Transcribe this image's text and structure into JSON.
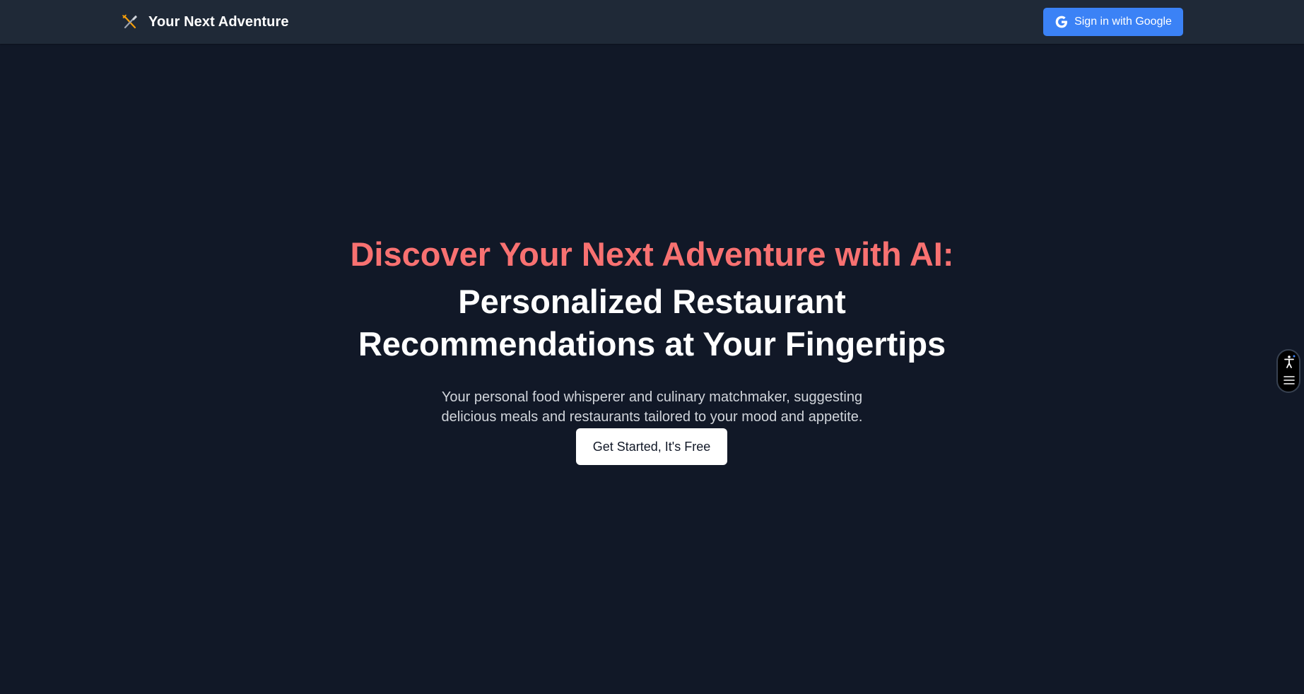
{
  "navbar": {
    "brand_icon": "fork-knife-icon",
    "brand_title": "Your Next Adventure",
    "signin_icon": "google-g-icon",
    "signin_label": "Sign in with Google"
  },
  "hero": {
    "headline_accent": "Discover Your Next Adventure with AI:",
    "headline_main_line1": "Personalized Restaurant",
    "headline_main_line2": "Recommendations at Your Fingertips",
    "subtitle_line1": "Your personal food whisperer and culinary matchmaker, suggesting",
    "subtitle_line2": "delicious meals and restaurants tailored to your mood and appetite.",
    "cta_label": "Get Started, It's Free"
  },
  "accessibility_widget": {
    "icons": [
      "accessibility-person-icon",
      "hamburger-menu-icon"
    ]
  },
  "colors": {
    "page_background": "#111827",
    "navbar_background": "#1f2937",
    "accent_red": "#f87171",
    "signin_blue": "#3b82f6",
    "text_white": "#ffffff",
    "subtitle_gray": "#d1d5db"
  }
}
